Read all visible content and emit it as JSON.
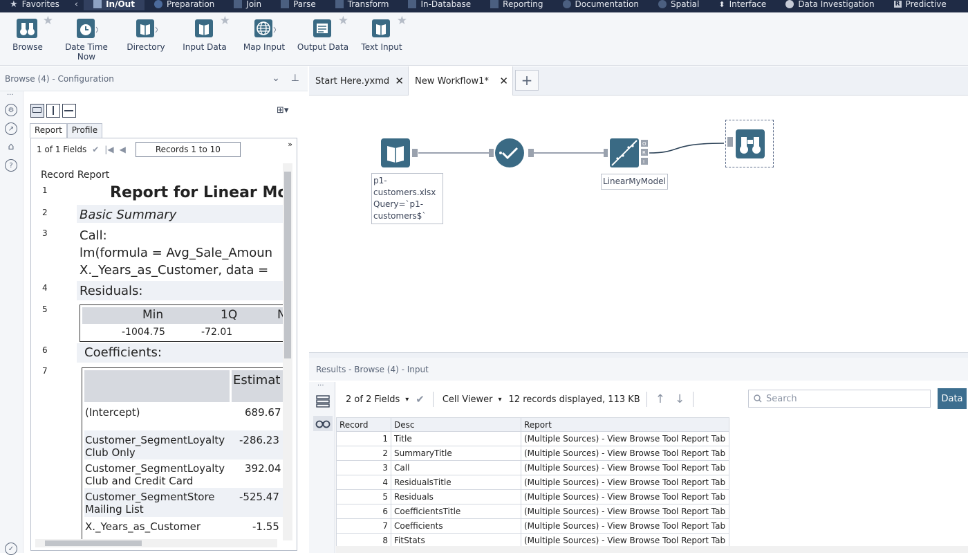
{
  "topbar": {
    "categories": [
      {
        "label": "Favorites",
        "icon": "star-icon"
      },
      {
        "label": "In/Out",
        "icon": "inout-icon",
        "active": true
      },
      {
        "label": "Preparation",
        "icon": "preparation-icon"
      },
      {
        "label": "Join",
        "icon": "join-icon"
      },
      {
        "label": "Parse",
        "icon": "parse-icon"
      },
      {
        "label": "Transform",
        "icon": "transform-icon"
      },
      {
        "label": "In-Database",
        "icon": "database-icon"
      },
      {
        "label": "Reporting",
        "icon": "reporting-icon"
      },
      {
        "label": "Documentation",
        "icon": "documentation-icon"
      },
      {
        "label": "Spatial",
        "icon": "globe-icon"
      },
      {
        "label": "Interface",
        "icon": "interface-icon"
      },
      {
        "label": "Data Investigation",
        "icon": "investigation-icon"
      },
      {
        "label": "Predictive",
        "icon": "r-icon"
      }
    ],
    "back": "‹"
  },
  "palette": {
    "tools": [
      {
        "label": "Browse",
        "icon": "binoculars-icon"
      },
      {
        "label": "Date Time Now",
        "icon": "clock-icon"
      },
      {
        "label": "Directory",
        "icon": "book-icon"
      },
      {
        "label": "Input Data",
        "icon": "book-icon"
      },
      {
        "label": "Map Input",
        "icon": "globe-icon"
      },
      {
        "label": "Output Data",
        "icon": "output-icon"
      },
      {
        "label": "Text Input",
        "icon": "book-icon"
      }
    ]
  },
  "config": {
    "title": "Browse (4) - Configuration",
    "tabs": [
      "Report",
      "Profile"
    ],
    "fields": "1 of 1 Fields",
    "records": "Records 1 to 10",
    "header": {
      "record": "Record",
      "report": "Report"
    },
    "rows": [
      {
        "n": "1",
        "text": "Report for Linear Mo"
      },
      {
        "n": "2",
        "text": "Basic Summary"
      },
      {
        "n": "3",
        "text": "Call:",
        "lines": [
          "lm(formula = Avg_Sale_Amoun",
          "X._Years_as_Customer, data ="
        ]
      },
      {
        "n": "4",
        "text": "Residuals:"
      },
      {
        "n": "5",
        "residuals": {
          "headers": [
            "Min",
            "1Q",
            "N"
          ],
          "values": [
            "-1004.75",
            "-72.01",
            ""
          ]
        }
      },
      {
        "n": "6",
        "text": "Coefficients:"
      },
      {
        "n": "7",
        "coefficients": {
          "header": "Estimat",
          "rows": [
            {
              "name": "(Intercept)",
              "value": "689.67"
            },
            {
              "name": "Customer_SegmentLoyalty Club Only",
              "value": "-286.23"
            },
            {
              "name": "Customer_SegmentLoyalty Club and Credit Card",
              "value": "392.04"
            },
            {
              "name": "Customer_SegmentStore Mailing List",
              "value": "-525.47"
            },
            {
              "name": "X._Years_as_Customer",
              "value": "-1.55"
            }
          ]
        }
      }
    ]
  },
  "doctabs": [
    {
      "label": "Start Here.yxmd"
    },
    {
      "label": "New Workflow1*",
      "active": true
    }
  ],
  "canvas": {
    "input_label": "p1-\ncustomers.xlsx\nQuery=`p1-\ncustomers$`",
    "model_label": "LinearMyModel"
  },
  "results": {
    "title": "Results - Browse (4) - Input",
    "fields": "2 of 2 Fields",
    "cell_viewer": "Cell Viewer",
    "summary": "12 records displayed, 113 KB",
    "search_placeholder": "Search",
    "data_button": "Data",
    "columns": [
      "Record",
      "Desc",
      "Report"
    ],
    "rows": [
      {
        "record": "1",
        "desc": "Title",
        "report": "(Multiple Sources) - View Browse Tool Report Tab"
      },
      {
        "record": "2",
        "desc": "SummaryTitle",
        "report": "(Multiple Sources) - View Browse Tool Report Tab"
      },
      {
        "record": "3",
        "desc": "Call",
        "report": "(Multiple Sources) - View Browse Tool Report Tab"
      },
      {
        "record": "4",
        "desc": "ResidualsTitle",
        "report": "(Multiple Sources) - View Browse Tool Report Tab"
      },
      {
        "record": "5",
        "desc": "Residuals",
        "report": "(Multiple Sources) - View Browse Tool Report Tab"
      },
      {
        "record": "6",
        "desc": "CoefficientsTitle",
        "report": "(Multiple Sources) - View Browse Tool Report Tab"
      },
      {
        "record": "7",
        "desc": "Coefficients",
        "report": "(Multiple Sources) - View Browse Tool Report Tab"
      },
      {
        "record": "8",
        "desc": "FitStats",
        "report": "(Multiple Sources) - View Browse Tool Report Tab"
      }
    ]
  },
  "colors": {
    "topbar": "#1f2b45",
    "node_teal": "#3a6a84",
    "data_button": "#3d6e8f"
  }
}
